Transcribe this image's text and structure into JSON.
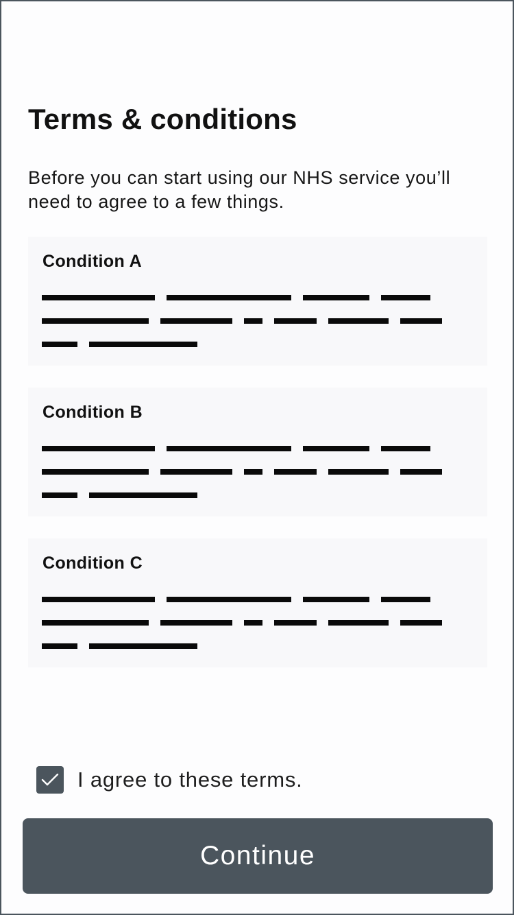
{
  "page": {
    "title": "Terms & conditions",
    "intro": "Before you can start using our NHS service you’ll need to agree to a few things."
  },
  "conditions": [
    {
      "heading": "Condition A"
    },
    {
      "heading": "Condition B"
    },
    {
      "heading": "Condition C"
    }
  ],
  "agreement": {
    "label": "I agree to these terms.",
    "checked": true,
    "icon": "checkmark-icon"
  },
  "continue_button": {
    "label": "Continue"
  },
  "colors": {
    "primary": "#4b555d",
    "card_background": "#f8f8fa",
    "text": "#111111"
  }
}
